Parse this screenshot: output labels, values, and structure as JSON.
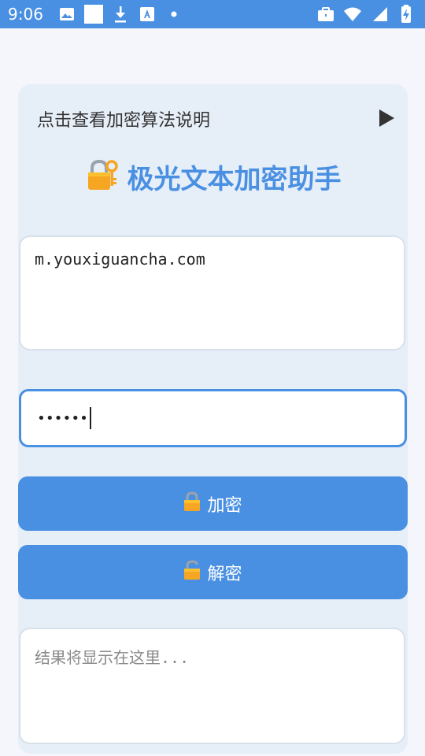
{
  "status_bar": {
    "time": "9:06",
    "left_icons": [
      "image-icon",
      "white-square-icon",
      "download-icon",
      "font-app-icon",
      "dot-icon"
    ],
    "right_icons": [
      "briefcase-icon",
      "wifi-icon",
      "signal-icon",
      "battery-charging-icon"
    ],
    "color": "#4A90E2"
  },
  "card": {
    "algo_toggle_label": "点击查看加密算法说明",
    "title": "极光文本加密助手",
    "title_icon": "lock-with-key-icon",
    "input_text": "m.youxiguancha.com",
    "key_masked": "••••••",
    "encrypt_button": {
      "icon": "lock-icon",
      "label": "加密"
    },
    "decrypt_button": {
      "icon": "unlock-icon",
      "label": "解密"
    },
    "result_placeholder": "结果将显示在这里..."
  },
  "colors": {
    "accent": "#4A90E2",
    "card_bg": "#E6EEF8",
    "page_bg": "#F4F6FB"
  }
}
